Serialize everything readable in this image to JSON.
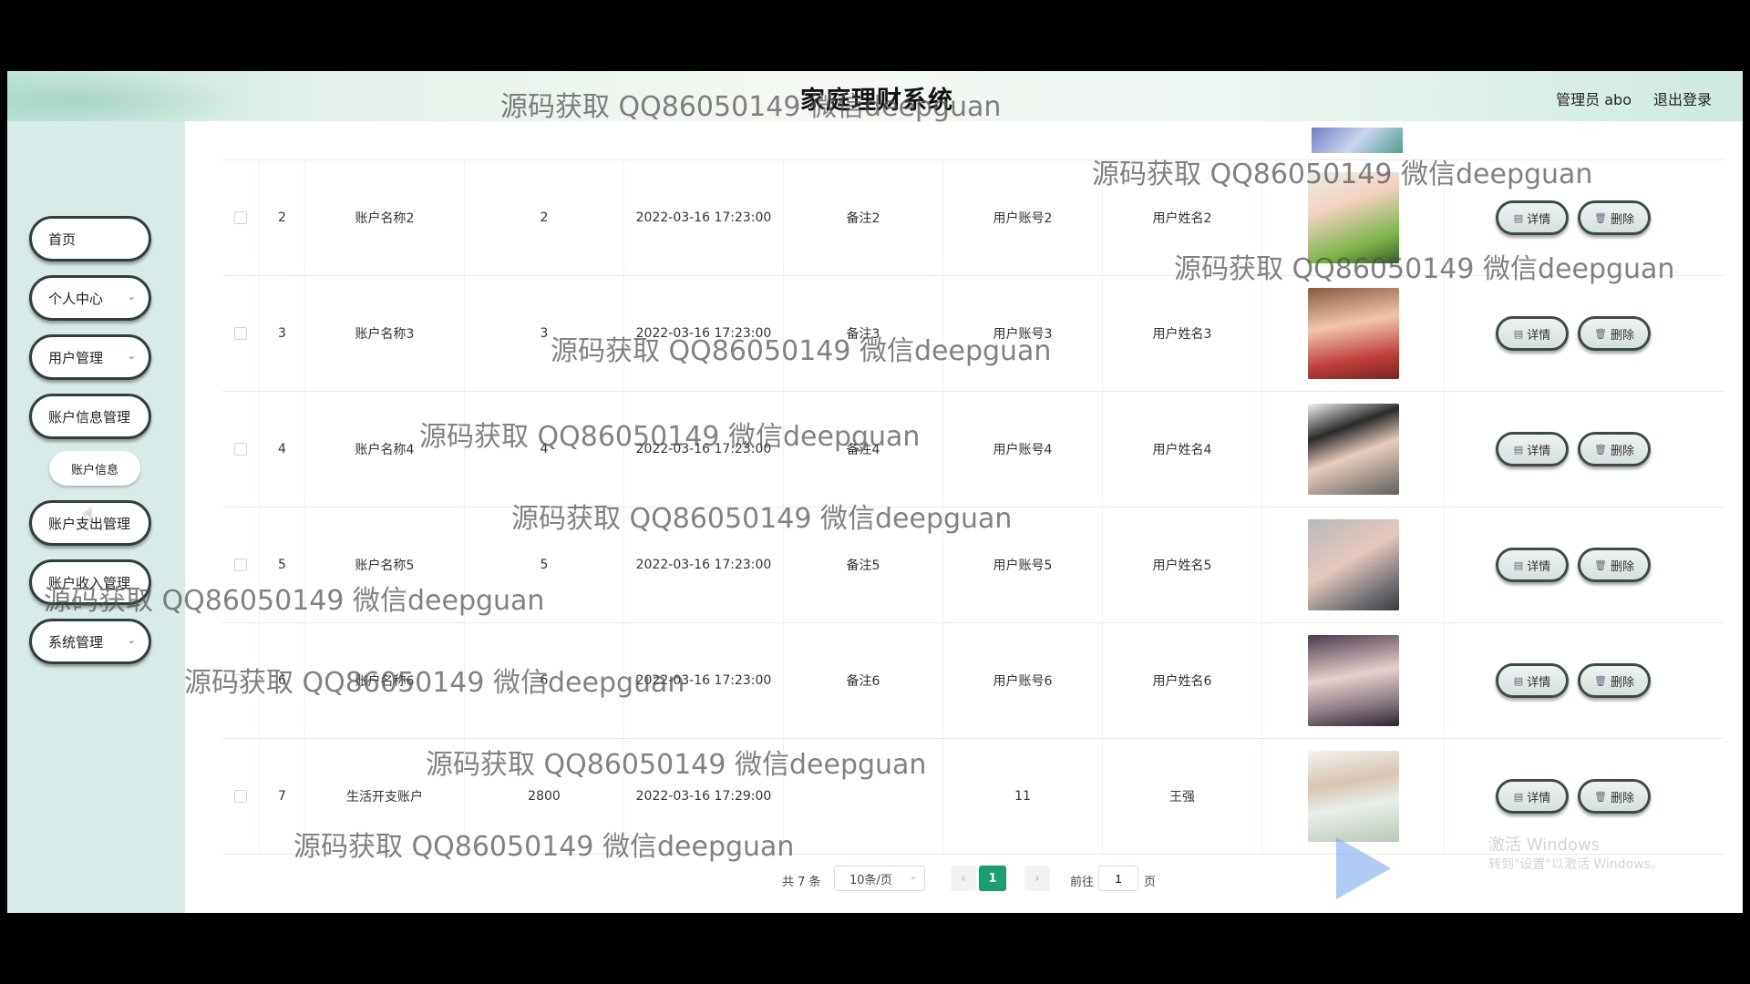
{
  "header": {
    "title": "家庭理财系统",
    "admin_label": "管理员 abo",
    "logout_label": "退出登录"
  },
  "sidebar": {
    "items": [
      {
        "label": "首页",
        "has_submenu": false
      },
      {
        "label": "个人中心",
        "has_submenu": true
      },
      {
        "label": "用户管理",
        "has_submenu": true
      },
      {
        "label": "账户信息管理",
        "has_submenu": false
      },
      {
        "label": "账户支出管理",
        "has_submenu": false
      },
      {
        "label": "账户收入管理",
        "has_submenu": false
      },
      {
        "label": "系统管理",
        "has_submenu": true
      }
    ],
    "sub_items": [
      {
        "label": "账户信息"
      }
    ]
  },
  "table": {
    "rows": [
      {
        "index": "2",
        "name": "账户名称2",
        "amount": "2",
        "time": "2022-03-16 17:23:00",
        "remark": "备注2",
        "account": "用户账号2",
        "username": "用户姓名2"
      },
      {
        "index": "3",
        "name": "账户名称3",
        "amount": "3",
        "time": "2022-03-16 17:23:00",
        "remark": "备注3",
        "account": "用户账号3",
        "username": "用户姓名3"
      },
      {
        "index": "4",
        "name": "账户名称4",
        "amount": "4",
        "time": "2022-03-16 17:23:00",
        "remark": "备注4",
        "account": "用户账号4",
        "username": "用户姓名4"
      },
      {
        "index": "5",
        "name": "账户名称5",
        "amount": "5",
        "time": "2022-03-16 17:23:00",
        "remark": "备注5",
        "account": "用户账号5",
        "username": "用户姓名5"
      },
      {
        "index": "6",
        "name": "账户名称6",
        "amount": "6",
        "time": "2022-03-16 17:23:00",
        "remark": "备注6",
        "account": "用户账号6",
        "username": "用户姓名6"
      },
      {
        "index": "7",
        "name": "生活开支账户",
        "amount": "2800",
        "time": "2022-03-16 17:29:00",
        "remark": "",
        "account": "11",
        "username": "王强"
      }
    ],
    "detail_label": "详情",
    "delete_label": "删除"
  },
  "pagination": {
    "total": "共 7 条",
    "page_size": "10条/页",
    "current_page": "1",
    "goto_label": "前往",
    "goto_value": "1",
    "page_unit": "页",
    "prev": "‹",
    "next": "›"
  },
  "watermark": "源码获取 QQ86050149 微信deepguan",
  "overlay": {
    "activate_title": "激活 Windows",
    "activate_sub": "转到\"设置\"以激活 Windows。"
  },
  "colors": {
    "accent": "#1a9e6e",
    "sidebar_bg": "#d9ebe9"
  }
}
